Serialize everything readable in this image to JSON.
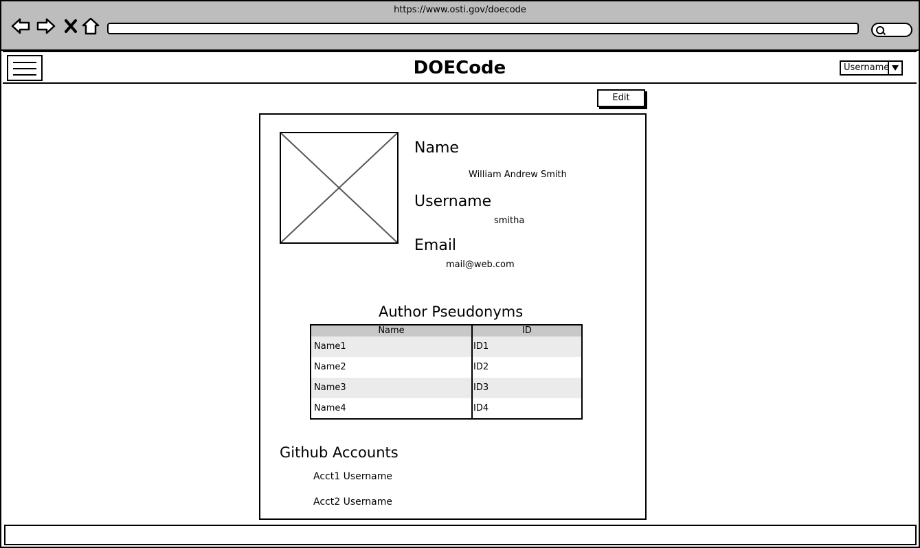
{
  "browser": {
    "url": "https://www.osti.gov/doecode"
  },
  "app": {
    "title": "DOECode",
    "user_menu_label": "Username"
  },
  "toolbar": {
    "edit_label": "Edit"
  },
  "profile": {
    "name_label": "Name",
    "name_value": "William Andrew Smith",
    "username_label": "Username",
    "username_value": "smitha",
    "email_label": "Email",
    "email_value": "mail@web.com"
  },
  "pseudonyms": {
    "title": "Author Pseudonyms",
    "columns": [
      "Name",
      "ID"
    ],
    "rows": [
      [
        "Name1",
        "ID1"
      ],
      [
        "Name2",
        "ID2"
      ],
      [
        "Name3",
        "ID3"
      ],
      [
        "Name4",
        "ID4"
      ]
    ]
  },
  "github": {
    "title": "Github Accounts",
    "accounts": [
      "Acct1 Username",
      "Acct2 Username"
    ]
  },
  "icons": {
    "back": "back-arrow-icon",
    "forward": "forward-arrow-icon",
    "stop": "close-icon",
    "home": "home-icon",
    "search": "search-icon",
    "menu": "hamburger-menu-icon",
    "dropdown": "chevron-down-icon",
    "avatar": "image-placeholder-icon"
  }
}
